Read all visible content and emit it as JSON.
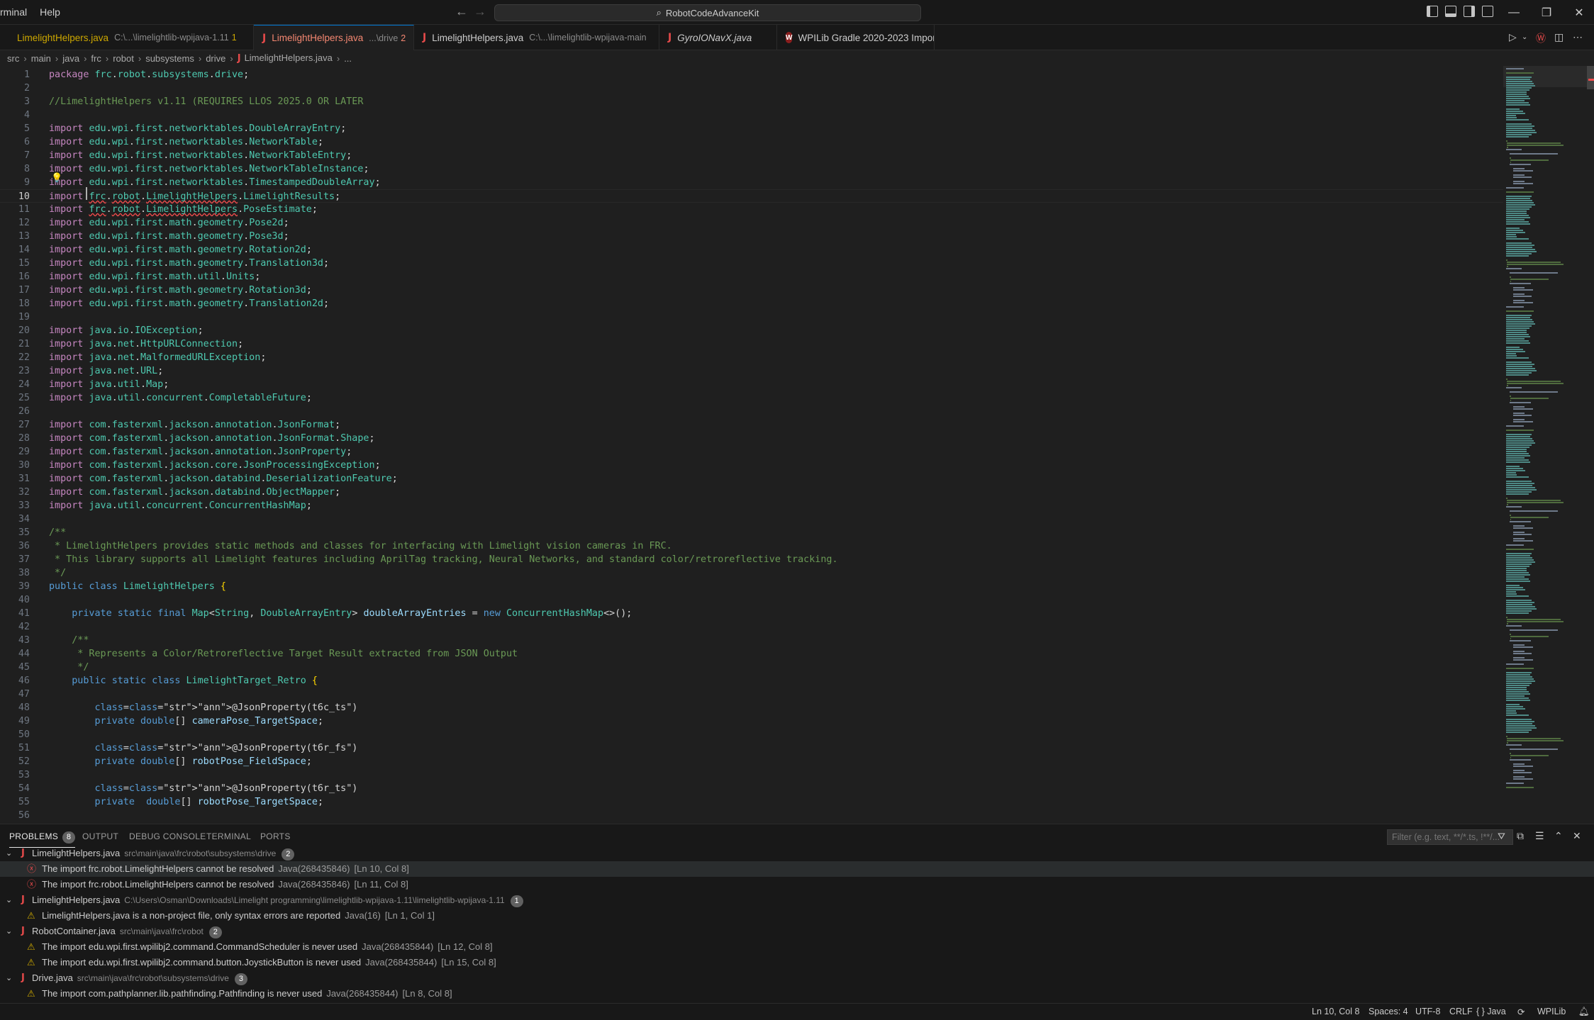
{
  "titlebar": {
    "menu": [
      "rminal",
      "Help"
    ],
    "command_center": "RobotCodeAdvanceKit",
    "window_controls": [
      "minimize",
      "restore",
      "close"
    ]
  },
  "tabs": [
    {
      "name": "LimelightHelpers.java",
      "desc": "C:\\...\\limelightlib-wpijava-1.11",
      "badge": "1",
      "state": "warn"
    },
    {
      "name": "LimelightHelpers.java",
      "desc": "...\\drive",
      "badge": "2",
      "state": "active"
    },
    {
      "name": "LimelightHelpers.java",
      "desc": "C:\\...\\limelightlib-wpijava-main",
      "badge": "",
      "state": "normal"
    },
    {
      "name": "GyroIONavX.java",
      "desc": "",
      "badge": "",
      "state": "italic"
    },
    {
      "name": "WPILib Gradle 2020-2023 Import",
      "desc": "",
      "badge": "",
      "state": "wpilib"
    }
  ],
  "breadcrumb": [
    "src",
    "main",
    "java",
    "frc",
    "robot",
    "subsystems",
    "drive",
    "LimelightHelpers.java",
    "..."
  ],
  "editor": {
    "current_line": 10,
    "lines": [
      "package frc.robot.subsystems.drive;",
      "",
      "//LimelightHelpers v1.11 (REQUIRES LLOS 2025.0 OR LATER",
      "",
      "import edu.wpi.first.networktables.DoubleArrayEntry;",
      "import edu.wpi.first.networktables.NetworkTable;",
      "import edu.wpi.first.networktables.NetworkTableEntry;",
      "import edu.wpi.first.networktables.NetworkTableInstance;",
      "import edu.wpi.first.networktables.TimestampedDoubleArray;",
      "import frc.robot.LimelightHelpers.LimelightResults;",
      "import frc.robot.LimelightHelpers.PoseEstimate;",
      "import edu.wpi.first.math.geometry.Pose2d;",
      "import edu.wpi.first.math.geometry.Pose3d;",
      "import edu.wpi.first.math.geometry.Rotation2d;",
      "import edu.wpi.first.math.geometry.Translation3d;",
      "import edu.wpi.first.math.util.Units;",
      "import edu.wpi.first.math.geometry.Rotation3d;",
      "import edu.wpi.first.math.geometry.Translation2d;",
      "",
      "import java.io.IOException;",
      "import java.net.HttpURLConnection;",
      "import java.net.MalformedURLException;",
      "import java.net.URL;",
      "import java.util.Map;",
      "import java.util.concurrent.CompletableFuture;",
      "",
      "import com.fasterxml.jackson.annotation.JsonFormat;",
      "import com.fasterxml.jackson.annotation.JsonFormat.Shape;",
      "import com.fasterxml.jackson.annotation.JsonProperty;",
      "import com.fasterxml.jackson.core.JsonProcessingException;",
      "import com.fasterxml.jackson.databind.DeserializationFeature;",
      "import com.fasterxml.jackson.databind.ObjectMapper;",
      "import java.util.concurrent.ConcurrentHashMap;",
      "",
      "/**",
      " * LimelightHelpers provides static methods and classes for interfacing with Limelight vision cameras in FRC.",
      " * This library supports all Limelight features including AprilTag tracking, Neural Networks, and standard color/retroreflective tracking.",
      " */",
      "public class LimelightHelpers {",
      "",
      "    private static final Map<String, DoubleArrayEntry> doubleArrayEntries = new ConcurrentHashMap<>();",
      "",
      "    /**",
      "     * Represents a Color/Retroreflective Target Result extracted from JSON Output",
      "     */",
      "    public static class LimelightTarget_Retro {",
      "",
      "        @JsonProperty(\"t6c_ts\")",
      "        private double[] cameraPose_TargetSpace;",
      "",
      "        @JsonProperty(\"t6r_fs\")",
      "        private double[] robotPose_FieldSpace;",
      "",
      "        @JsonProperty(\"t6r_ts\")",
      "        private  double[] robotPose_TargetSpace;",
      ""
    ]
  },
  "panel": {
    "tabs": [
      {
        "label": "PROBLEMS",
        "count": "8"
      },
      {
        "label": "OUTPUT",
        "count": ""
      },
      {
        "label": "DEBUG CONSOLE",
        "count": ""
      },
      {
        "label": "TERMINAL",
        "count": ""
      },
      {
        "label": "PORTS",
        "count": ""
      }
    ],
    "filter_placeholder": "Filter (e.g. text, **/*.ts, !**/...",
    "problems": [
      {
        "kind": "file",
        "name": "LimelightHelpers.java",
        "path": "src\\main\\java\\frc\\robot\\subsystems\\drive",
        "count": "2"
      },
      {
        "kind": "item",
        "severity": "error",
        "message": "The import frc.robot.LimelightHelpers cannot be resolved",
        "source": "Java(268435846)",
        "position": "[Ln 10, Col 8]",
        "selected": true
      },
      {
        "kind": "item",
        "severity": "error",
        "message": "The import frc.robot.LimelightHelpers cannot be resolved",
        "source": "Java(268435846)",
        "position": "[Ln 11, Col 8]"
      },
      {
        "kind": "file",
        "name": "LimelightHelpers.java",
        "path": "C:\\Users\\Osman\\Downloads\\Limelight programming\\limelightlib-wpijava-1.11\\limelightlib-wpijava-1.11",
        "count": "1"
      },
      {
        "kind": "item",
        "severity": "warning",
        "message": "LimelightHelpers.java is a non-project file, only syntax errors are reported",
        "source": "Java(16)",
        "position": "[Ln 1, Col 1]"
      },
      {
        "kind": "file",
        "name": "RobotContainer.java",
        "path": "src\\main\\java\\frc\\robot",
        "count": "2"
      },
      {
        "kind": "item",
        "severity": "warning",
        "message": "The import edu.wpi.first.wpilibj2.command.CommandScheduler is never used",
        "source": "Java(268435844)",
        "position": "[Ln 12, Col 8]"
      },
      {
        "kind": "item",
        "severity": "warning",
        "message": "The import edu.wpi.first.wpilibj2.command.button.JoystickButton is never used",
        "source": "Java(268435844)",
        "position": "[Ln 15, Col 8]"
      },
      {
        "kind": "file",
        "name": "Drive.java",
        "path": "src\\main\\java\\frc\\robot\\subsystems\\drive",
        "count": "3"
      },
      {
        "kind": "item",
        "severity": "warning",
        "message": "The import com.pathplanner.lib.pathfinding.Pathfinding is never used",
        "source": "Java(268435844)",
        "position": "[Ln 8, Col 8]"
      }
    ]
  },
  "statusbar": {
    "position": "Ln 10, Col 8",
    "spaces": "Spaces: 4",
    "encoding": "UTF-8",
    "eol": "CRLF",
    "language": "{ } Java",
    "extension": "WPILib"
  },
  "colors": {
    "accent": "#0078d4",
    "error": "#f14c4c",
    "warning": "#cca700",
    "java_icon": "#e64a4a"
  }
}
